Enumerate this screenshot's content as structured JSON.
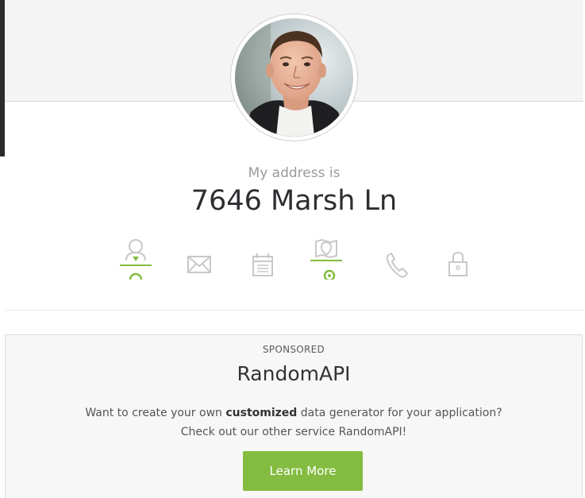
{
  "profile": {
    "label": "My address is",
    "value": "7646 Marsh Ln",
    "selected_icon": "map-icon"
  },
  "icons": [
    {
      "name": "user-icon",
      "active": true
    },
    {
      "name": "mail-icon",
      "active": false
    },
    {
      "name": "calendar-icon",
      "active": false
    },
    {
      "name": "map-icon",
      "active": true
    },
    {
      "name": "phone-icon",
      "active": false
    },
    {
      "name": "lock-icon",
      "active": false
    }
  ],
  "sponsored": {
    "label": "SPONSORED",
    "title": "RandomAPI",
    "line1_before": "Want to create your own ",
    "line1_bold": "customized",
    "line1_after": " data generator for your application?",
    "line2": "Check out our other service RandomAPI!",
    "button_label": "Learn More"
  },
  "colors": {
    "accent": "#84bc41",
    "icon_inactive": "#c8c8c8",
    "text_dark": "#2c2e31"
  }
}
